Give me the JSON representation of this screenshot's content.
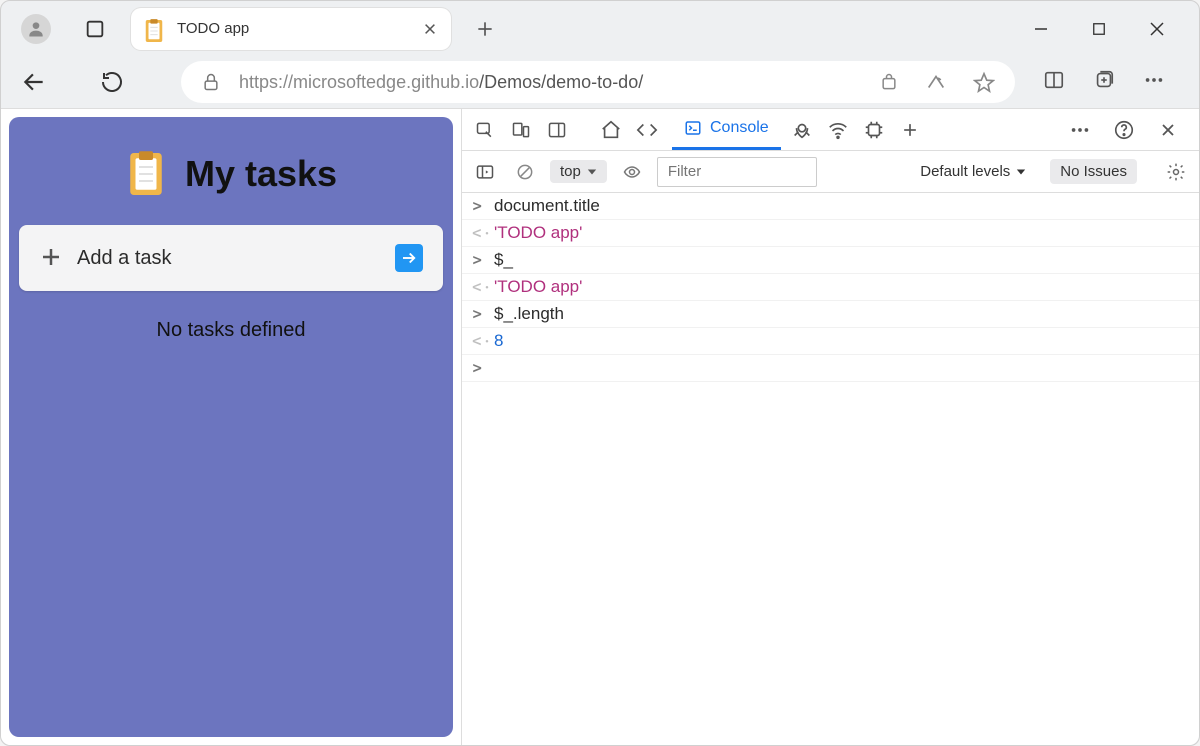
{
  "browser": {
    "tab": {
      "title": "TODO app"
    },
    "url_host": "https://microsoftedge.github.io",
    "url_path": "/Demos/demo-to-do/"
  },
  "app": {
    "title": "My tasks",
    "add_task_label": "Add a task",
    "empty_message": "No tasks defined"
  },
  "devtools": {
    "console_tab_label": "Console",
    "context": "top",
    "filter_placeholder": "Filter",
    "levels_label": "Default levels",
    "issues_label": "No Issues",
    "lines": [
      {
        "kind": "input",
        "text": "document.title"
      },
      {
        "kind": "output",
        "type": "string",
        "text": "'TODO app'"
      },
      {
        "kind": "input",
        "text": "$_"
      },
      {
        "kind": "output",
        "type": "string",
        "text": "'TODO app'"
      },
      {
        "kind": "input",
        "text": "$_.length"
      },
      {
        "kind": "output",
        "type": "number",
        "text": "8"
      }
    ]
  }
}
